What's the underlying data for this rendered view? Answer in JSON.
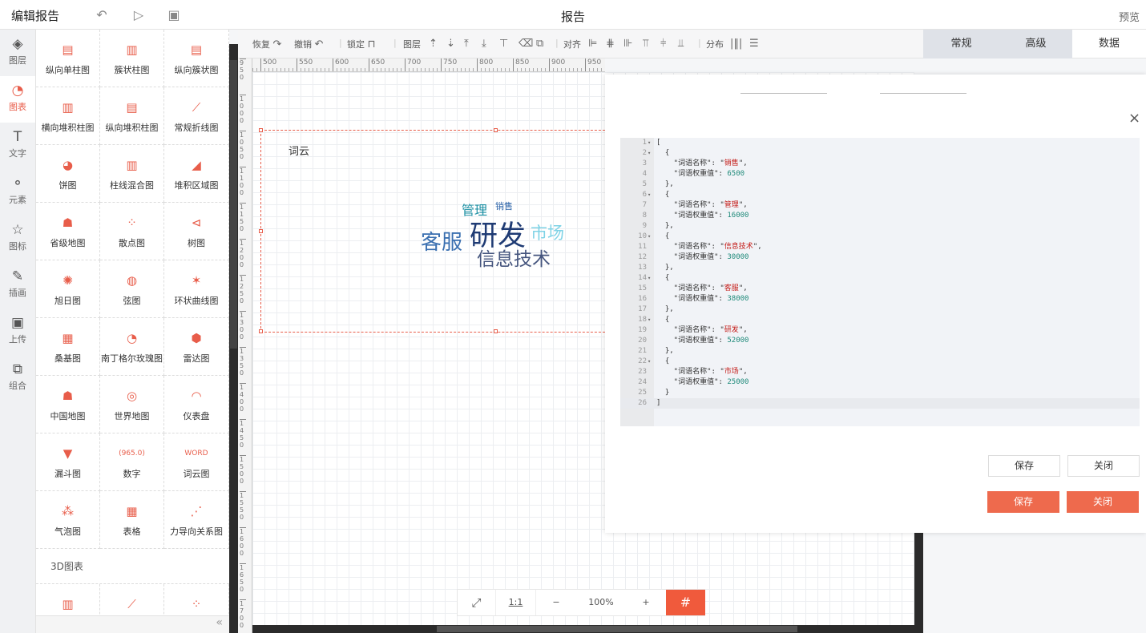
{
  "topbar": {
    "title": "编辑报告",
    "center_title": "报告",
    "preview": "预览"
  },
  "iconbar": [
    {
      "label": "图层",
      "icon": "layers-icon",
      "glyph": "◈"
    },
    {
      "label": "图表",
      "icon": "chart-clock-icon",
      "glyph": "◔",
      "active": true
    },
    {
      "label": "文字",
      "icon": "text-icon",
      "glyph": "T"
    },
    {
      "label": "元素",
      "icon": "elements-icon",
      "glyph": "⚬"
    },
    {
      "label": "图标",
      "icon": "star-icon",
      "glyph": "☆"
    },
    {
      "label": "插画",
      "icon": "palette-icon",
      "glyph": "✎"
    },
    {
      "label": "上传",
      "icon": "image-upload-icon",
      "glyph": "▣"
    },
    {
      "label": "组合",
      "icon": "group-icon",
      "glyph": "⧉"
    }
  ],
  "palette": {
    "items": [
      {
        "label": "纵向单柱图",
        "icon": "▤"
      },
      {
        "label": "簇状柱图",
        "icon": "▥"
      },
      {
        "label": "纵向簇状图",
        "icon": "▤"
      },
      {
        "label": "横向堆积柱图",
        "icon": "▥"
      },
      {
        "label": "纵向堆积柱图",
        "icon": "▤"
      },
      {
        "label": "常规折线图",
        "icon": "⟋"
      },
      {
        "label": "饼图",
        "icon": "◕"
      },
      {
        "label": "柱线混合图",
        "icon": "▥"
      },
      {
        "label": "堆积区域图",
        "icon": "◢"
      },
      {
        "label": "省级地图",
        "icon": "☗"
      },
      {
        "label": "散点图",
        "icon": "⁘"
      },
      {
        "label": "树图",
        "icon": "⊲"
      },
      {
        "label": "旭日图",
        "icon": "✺"
      },
      {
        "label": "弦图",
        "icon": "◍"
      },
      {
        "label": "环状曲线图",
        "icon": "✶"
      },
      {
        "label": "桑基图",
        "icon": "▦"
      },
      {
        "label": "南丁格尔玫瑰图",
        "icon": "◔"
      },
      {
        "label": "雷达图",
        "icon": "⬢"
      },
      {
        "label": "中国地图",
        "icon": "☗"
      },
      {
        "label": "世界地图",
        "icon": "◎"
      },
      {
        "label": "仪表盘",
        "icon": "◠"
      },
      {
        "label": "漏斗图",
        "icon": "▼"
      },
      {
        "label": "数字",
        "icon": "(965.0)"
      },
      {
        "label": "词云图",
        "icon": "WORD"
      },
      {
        "label": "气泡图",
        "icon": "⁂"
      },
      {
        "label": "表格",
        "icon": "▦"
      },
      {
        "label": "力导向关系图",
        "icon": "⋰"
      }
    ],
    "section3d": "3D图表",
    "items3d": [
      {
        "icon": "▥"
      },
      {
        "icon": "⟋"
      },
      {
        "icon": "⁘"
      }
    ],
    "collapse": "«"
  },
  "toolbar": {
    "redo": "恢复",
    "undo": "撤销",
    "lock": "锁定",
    "layer": "图层",
    "align": "对齐",
    "distribute": "分布"
  },
  "ruler": {
    "top": [
      "500",
      "550",
      "600",
      "650",
      "700",
      "750",
      "800",
      "850",
      "900",
      "950"
    ],
    "left": [
      "950",
      "1000",
      "1050",
      "1100",
      "1150",
      "1200",
      "1250",
      "1300",
      "1350",
      "1400",
      "1450",
      "1500",
      "1550",
      "1600",
      "1650",
      "1700"
    ]
  },
  "widget": {
    "title": "词云"
  },
  "wordcloud": [
    {
      "text": "研发",
      "color": "#1f3b74"
    },
    {
      "text": "客服",
      "color": "#3a6fb0"
    },
    {
      "text": "信息技术",
      "color": "#45557e"
    },
    {
      "text": "市场",
      "color": "#7fd3e6"
    },
    {
      "text": "管理",
      "color": "#1b8fa3"
    },
    {
      "text": "销售",
      "color": "#2a62a8"
    }
  ],
  "zoom": {
    "fit": "⤢",
    "one": "1:1",
    "minus": "−",
    "value": "100%",
    "plus": "+",
    "grid": "#"
  },
  "rtabs": [
    "常规",
    "高级",
    "数据"
  ],
  "dialog": {
    "close": "×",
    "json": [
      {
        "name": "销售",
        "weight": 6500
      },
      {
        "name": "管理",
        "weight": 16000
      },
      {
        "name": "信息技术",
        "weight": 30000
      },
      {
        "name": "客服",
        "weight": 38000
      },
      {
        "name": "研发",
        "weight": 52000
      },
      {
        "name": "市场",
        "weight": 25000
      }
    ],
    "key_name": "词语名称",
    "key_weight": "词语权重值",
    "save": "保存",
    "close_label": "关闭"
  }
}
